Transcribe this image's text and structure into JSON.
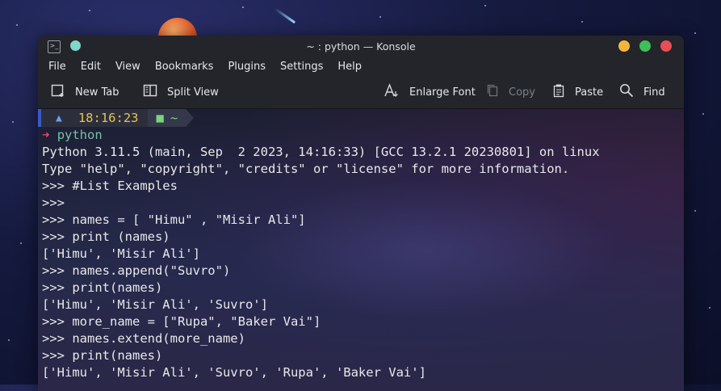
{
  "window": {
    "title": "~ : python — Konsole"
  },
  "menu": [
    "File",
    "Edit",
    "View",
    "Bookmarks",
    "Plugins",
    "Settings",
    "Help"
  ],
  "toolbar": {
    "new_tab": "New Tab",
    "split_view": "Split View",
    "enlarge_font": "Enlarge Font",
    "copy": "Copy",
    "paste": "Paste",
    "find": "Find"
  },
  "prompt": {
    "time": "18:16:23",
    "dir": "~",
    "arrow": "➜",
    "command": "python"
  },
  "output": [
    "Python 3.11.5 (main, Sep  2 2023, 14:16:33) [GCC 13.2.1 20230801] on linux",
    "Type \"help\", \"copyright\", \"credits\" or \"license\" for more information.",
    ">>> #List Examples",
    ">>>",
    ">>> names = [ \"Himu\" , \"Misir Ali\"]",
    ">>> print (names)",
    "['Himu', 'Misir Ali']",
    ">>> names.append(\"Suvro\")",
    ">>> print(names)",
    "['Himu', 'Misir Ali', 'Suvro']",
    ">>> more_name = [\"Rupa\", \"Baker Vai\"]",
    ">>> names.extend(more_name)",
    ">>> print(names)",
    "['Himu', 'Misir Ali', 'Suvro', 'Rupa', 'Baker Vai']"
  ],
  "colors": {
    "minimize": "#f4b63a",
    "maximize": "#3fbf5a",
    "close": "#e84e55"
  }
}
